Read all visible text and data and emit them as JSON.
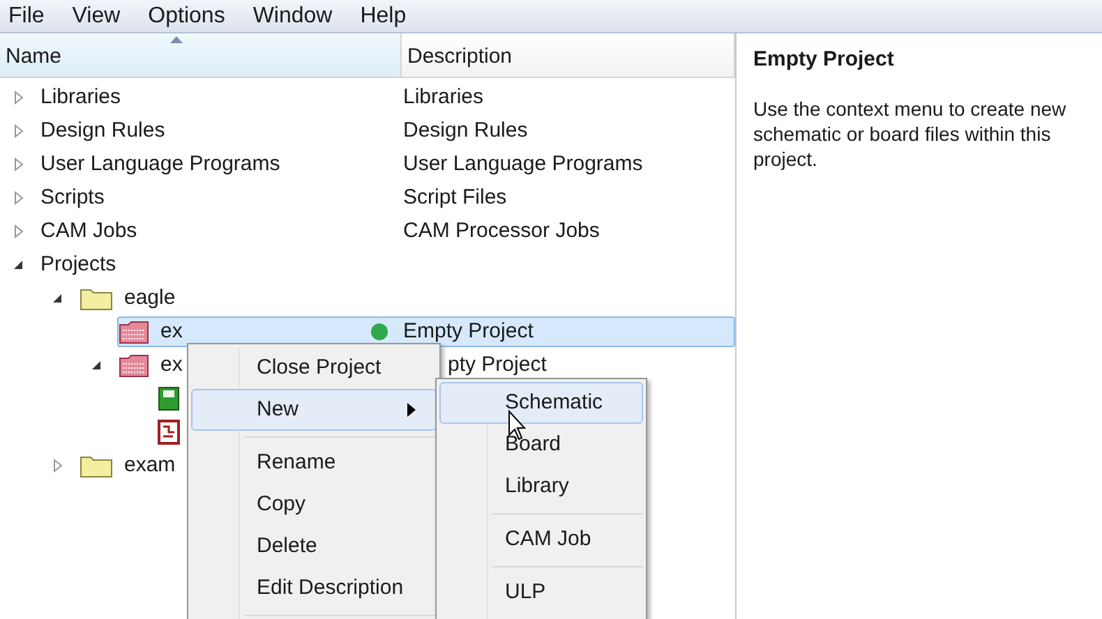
{
  "menubar": [
    "File",
    "View",
    "Options",
    "Window",
    "Help"
  ],
  "columns": [
    {
      "label": "Name",
      "sorted": true
    },
    {
      "label": "Description",
      "sorted": false
    }
  ],
  "tree": [
    {
      "name": "Libraries",
      "description": "Libraries",
      "kind": "category",
      "expanded": false,
      "selected": false
    },
    {
      "name": "Design Rules",
      "description": "Design Rules",
      "kind": "category",
      "expanded": false,
      "selected": false
    },
    {
      "name": "User Language Programs",
      "description": "User Language Programs",
      "kind": "category",
      "expanded": false,
      "selected": false
    },
    {
      "name": "Scripts",
      "description": "Script Files",
      "kind": "category",
      "expanded": false,
      "selected": false
    },
    {
      "name": "CAM Jobs",
      "description": "CAM Processor Jobs",
      "kind": "category",
      "expanded": false,
      "selected": false
    },
    {
      "name": "Projects",
      "kind": "category",
      "expanded": true,
      "selected": false,
      "children": [
        {
          "name": "eagle",
          "kind": "folder",
          "expanded": true,
          "selected": false,
          "children": [
            {
              "name": "ex",
              "description": "Empty Project",
              "kind": "project",
              "status_icon": true,
              "selected": true
            },
            {
              "name": "ex",
              "description": "pty Project",
              "partly_hidden": true,
              "kind": "project",
              "expanded": true,
              "selected": false,
              "children": [
                {
                  "kind": "schematic",
                  "selected": false
                },
                {
                  "kind": "board",
                  "selected": false
                }
              ]
            }
          ]
        },
        {
          "name": "exam",
          "kind": "folder",
          "expanded": false,
          "selected": false
        }
      ]
    }
  ],
  "info": {
    "title": "Empty Project",
    "text": "Use the context menu to create new schematic or board files within this project."
  },
  "context_menu": [
    {
      "kind": "item",
      "label": "Close Project",
      "selected": false,
      "submenu": false
    },
    {
      "kind": "item",
      "label": "New",
      "selected": true,
      "submenu": true
    },
    {
      "kind": "separator"
    },
    {
      "kind": "item",
      "label": "Rename",
      "selected": false,
      "submenu": false
    },
    {
      "kind": "item",
      "label": "Copy",
      "selected": false,
      "submenu": false
    },
    {
      "kind": "item",
      "label": "Delete",
      "selected": false,
      "submenu": false
    },
    {
      "kind": "item",
      "label": "Edit Description",
      "selected": false,
      "submenu": false
    },
    {
      "kind": "separator"
    }
  ],
  "submenu": [
    {
      "kind": "item",
      "label": "Schematic",
      "selected": true
    },
    {
      "kind": "item",
      "label": "Board",
      "selected": false
    },
    {
      "kind": "item",
      "label": "Library",
      "selected": false
    },
    {
      "kind": "separator"
    },
    {
      "kind": "item",
      "label": "CAM Job",
      "selected": false
    },
    {
      "kind": "separator"
    },
    {
      "kind": "item",
      "label": "ULP",
      "selected": false
    }
  ]
}
